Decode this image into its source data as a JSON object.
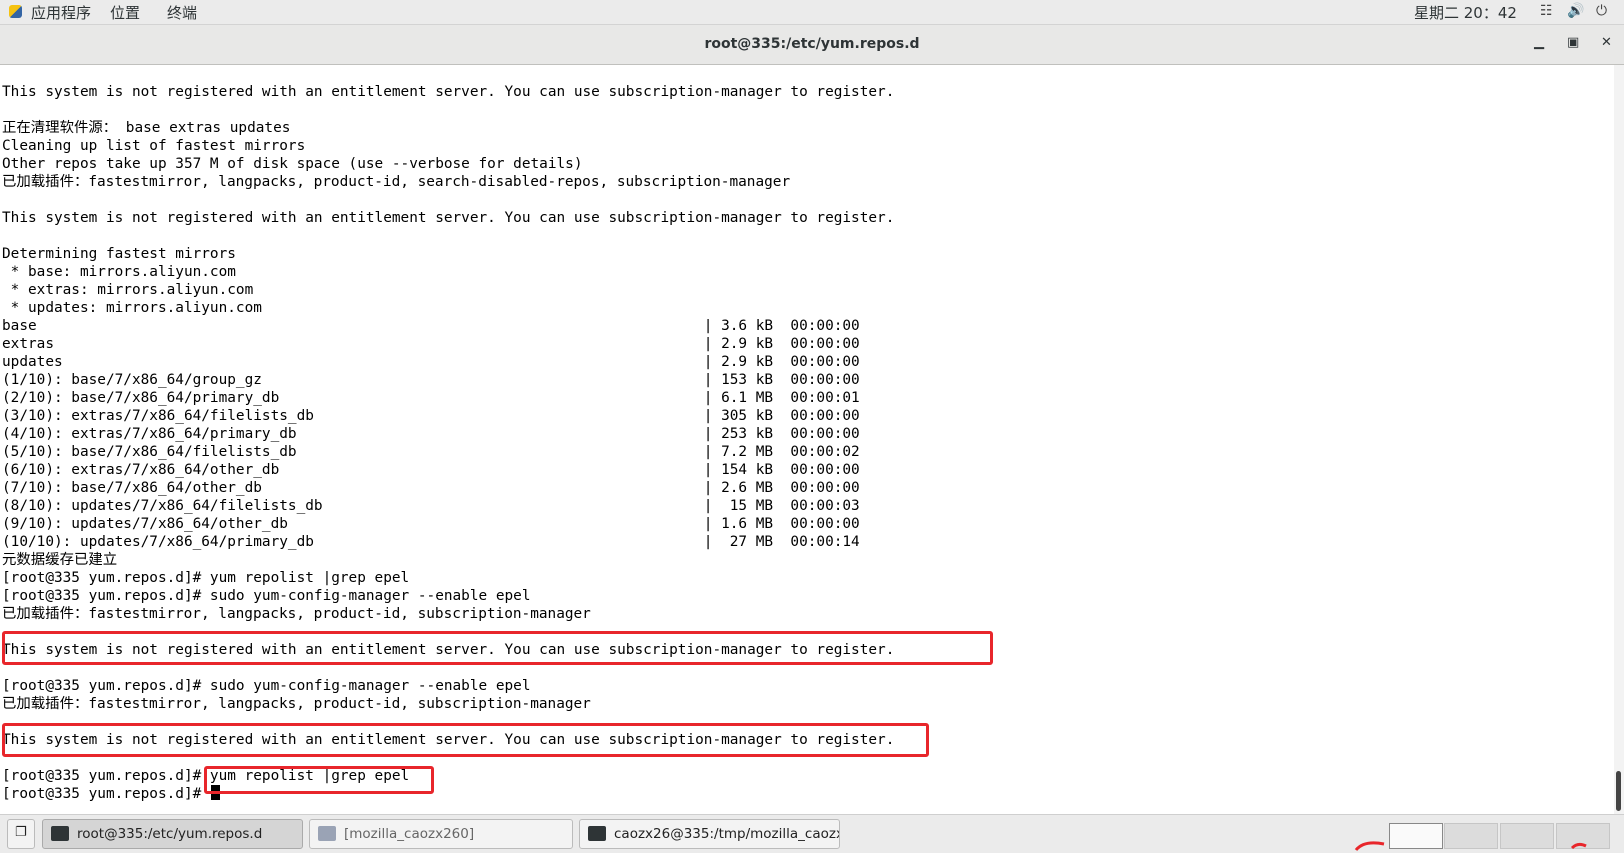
{
  "topbar": {
    "menus": [
      "应用程序",
      "位置",
      "终端"
    ],
    "clock": "星期二 20：42"
  },
  "window": {
    "title": "root@335:/etc/yum.repos.d"
  },
  "terminal": {
    "lines": [
      "This system is not registered with an entitlement server. You can use subscription-manager to register.",
      "",
      "正在清理软件源： base extras updates",
      "Cleaning up list of fastest mirrors",
      "Other repos take up 357 M of disk space (use --verbose for details)",
      "已加载插件：fastestmirror, langpacks, product-id, search-disabled-repos, subscription-manager",
      "",
      "This system is not registered with an entitlement server. You can use subscription-manager to register.",
      "",
      "Determining fastest mirrors",
      " * base: mirrors.aliyun.com",
      " * extras: mirrors.aliyun.com",
      " * updates: mirrors.aliyun.com",
      "base                                                                             | 3.6 kB  00:00:00",
      "extras                                                                           | 2.9 kB  00:00:00",
      "updates                                                                          | 2.9 kB  00:00:00",
      "(1/10): base/7/x86_64/group_gz                                                   | 153 kB  00:00:00",
      "(2/10): base/7/x86_64/primary_db                                                 | 6.1 MB  00:00:01",
      "(3/10): extras/7/x86_64/filelists_db                                             | 305 kB  00:00:00",
      "(4/10): extras/7/x86_64/primary_db                                               | 253 kB  00:00:00",
      "(5/10): base/7/x86_64/filelists_db                                               | 7.2 MB  00:00:02",
      "(6/10): extras/7/x86_64/other_db                                                 | 154 kB  00:00:00",
      "(7/10): base/7/x86_64/other_db                                                   | 2.6 MB  00:00:00",
      "(8/10): updates/7/x86_64/filelists_db                                            |  15 MB  00:00:03",
      "(9/10): updates/7/x86_64/other_db                                                | 1.6 MB  00:00:00",
      "(10/10): updates/7/x86_64/primary_db                                             |  27 MB  00:00:14",
      "元数据缓存已建立",
      "[root@335 yum.repos.d]# yum repolist |grep epel",
      "[root@335 yum.repos.d]# sudo yum-config-manager --enable epel",
      "已加载插件：fastestmirror, langpacks, product-id, subscription-manager",
      "",
      "This system is not registered with an entitlement server. You can use subscription-manager to register.",
      "",
      "[root@335 yum.repos.d]# sudo yum-config-manager --enable epel",
      "已加载插件：fastestmirror, langpacks, product-id, subscription-manager",
      "",
      "This system is not registered with an entitlement server. You can use subscription-manager to register.",
      "",
      "[root@335 yum.repos.d]# yum repolist |grep epel",
      "[root@335 yum.repos.d]# "
    ]
  },
  "taskbar": {
    "tasks": [
      {
        "label": "root@335:/etc/yum.repos.d"
      },
      {
        "label": "[mozilla_caozx260]"
      },
      {
        "label": "caozx26@335:/tmp/mozilla_caozx···"
      }
    ]
  },
  "colors": {
    "highlight": "#e8262b",
    "panel": "#ebebeb"
  },
  "icons": [
    "apps-icon",
    "network-icon",
    "volume-icon",
    "power-icon",
    "show-desktop-icon",
    "terminal-icon",
    "folder-icon"
  ]
}
